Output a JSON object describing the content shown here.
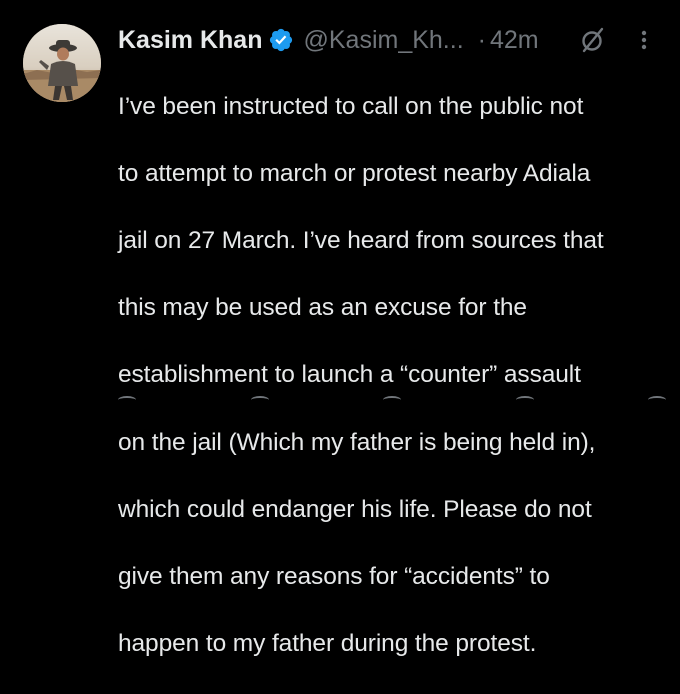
{
  "tweet": {
    "display_name": "Kasim Khan",
    "handle": "@Kasim_Kh...",
    "separator": "·",
    "timestamp": "42m",
    "lines": [
      "I’ve been instructed to call on the public not",
      "to attempt to march or protest nearby Adiala",
      "jail on 27 March. I’ve heard from sources that",
      "this may be used as an excuse for the",
      "establishment to launch a “counter” assault",
      "on the jail (Which my father is being held in),",
      "which could endanger his life. Please do not",
      "give them any reasons for “accidents” to",
      "happen to my father during the protest."
    ]
  },
  "icons": {
    "verified": "verified-badge-icon",
    "grok": "grok-icon",
    "more": "more-options-icon"
  },
  "colors": {
    "background": "#000000",
    "primary_text": "#e7e9ea",
    "secondary_text": "#71767b",
    "verified_blue": "#1d9bf0"
  }
}
